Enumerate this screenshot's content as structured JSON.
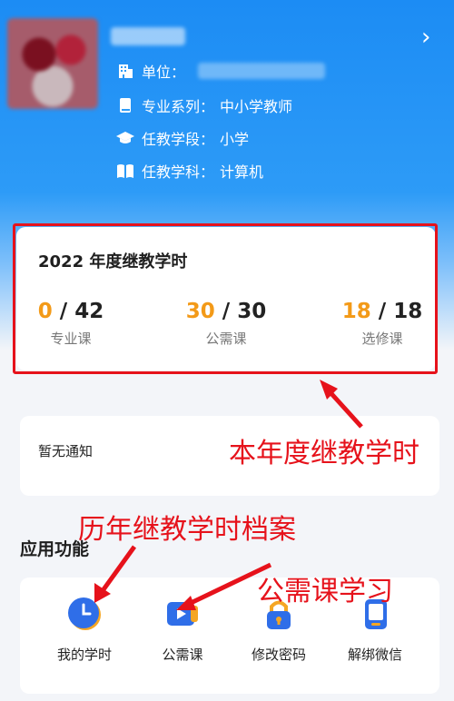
{
  "profile": {
    "unit_label": "单位：",
    "major_label": "专业系列：",
    "major_value": "中小学教师",
    "stage_label": "任教学段：",
    "stage_value": "小学",
    "subject_label": "任教学科：",
    "subject_value": "计算机"
  },
  "hours_card": {
    "title": "2022 年度继教学时",
    "stats": [
      {
        "done": "0",
        "total": "42",
        "label": "专业课"
      },
      {
        "done": "30",
        "total": "30",
        "label": "公需课"
      },
      {
        "done": "18",
        "total": "18",
        "label": "选修课"
      }
    ]
  },
  "notice": {
    "text": "暂无通知"
  },
  "apps": {
    "title": "应用功能",
    "items": [
      {
        "label": "我的学时",
        "icon": "clock-icon"
      },
      {
        "label": "公需课",
        "icon": "video-play-icon"
      },
      {
        "label": "修改密码",
        "icon": "lock-icon"
      },
      {
        "label": "解绑微信",
        "icon": "phone-icon"
      }
    ]
  },
  "annotations": {
    "year_hours": "本年度继教学时",
    "history_archive": "历年继教学时档案",
    "public_course": "公需课学习"
  },
  "colors": {
    "primary_blue": "#1c8cf4",
    "accent_orange": "#f39a18",
    "annotation_red": "#e6121b"
  }
}
